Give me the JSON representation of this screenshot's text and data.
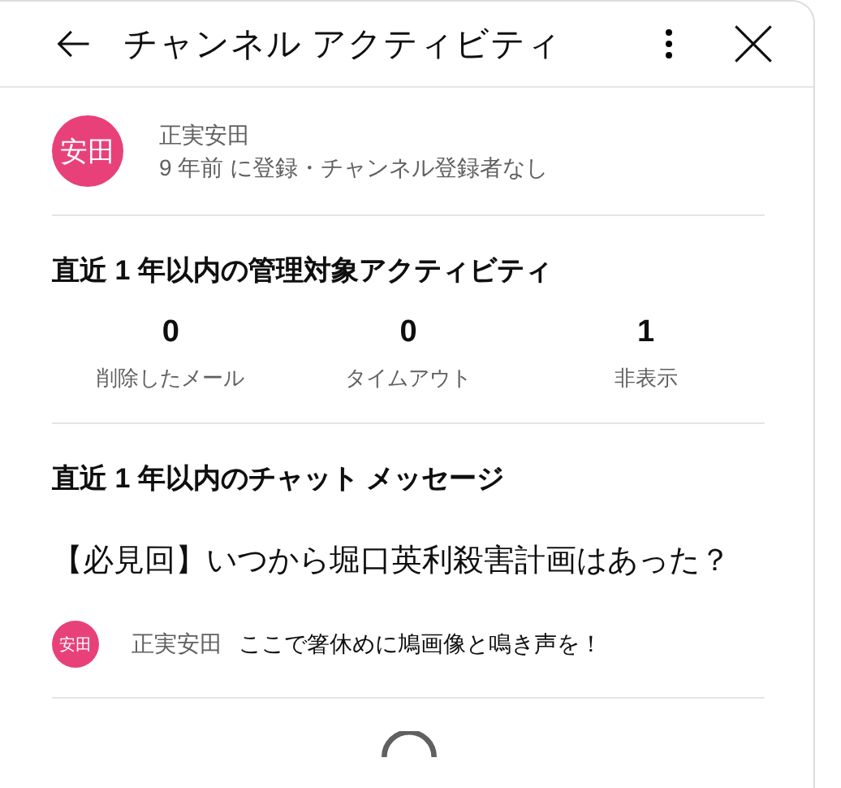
{
  "header": {
    "title": "チャンネル アクティビティ"
  },
  "profile": {
    "avatar_text": "安田",
    "name": "正実安田",
    "meta": "9 年前 に登録・チャンネル登録者なし"
  },
  "moderation": {
    "title": "直近 1 年以内の管理対象アクティビティ",
    "stats": [
      {
        "value": "0",
        "label": "削除したメール"
      },
      {
        "value": "0",
        "label": "タイムアウト"
      },
      {
        "value": "1",
        "label": "非表示"
      }
    ]
  },
  "chat": {
    "title": "直近 1 年以内のチャット メッセージ",
    "messages": [
      {
        "video_title": "【必見回】いつから堀口英利殺害計画はあった？",
        "avatar_text": "安田",
        "author": "正実安田",
        "text": "ここで箸休めに鳩画像と鳴き声を！"
      }
    ]
  },
  "loading": true
}
